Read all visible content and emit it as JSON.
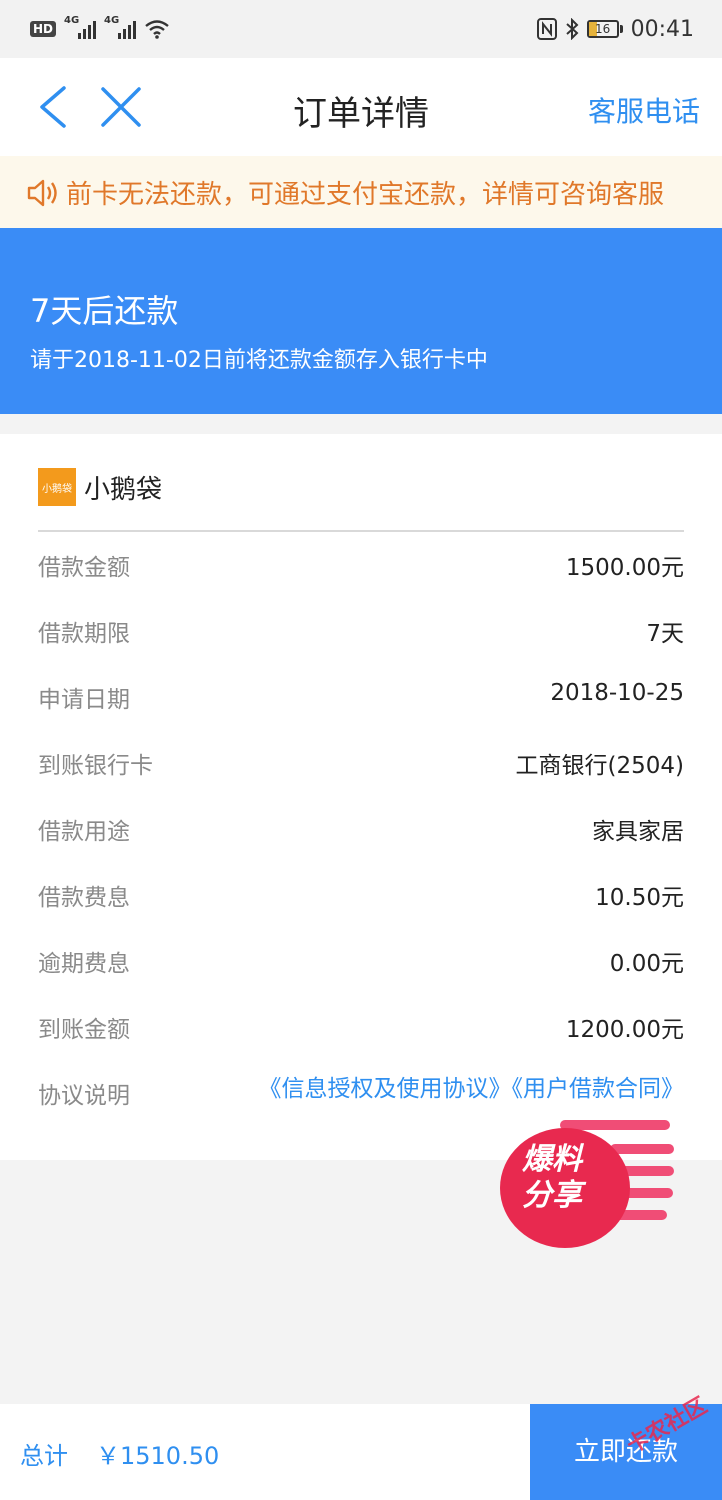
{
  "status_bar": {
    "hd": "HD",
    "net1": "4G",
    "net2": "4G",
    "battery": "16",
    "time": "00:41"
  },
  "nav": {
    "title": "订单详情",
    "service": "客服电话"
  },
  "notice": {
    "text": "前卡无法还款，可通过支付宝还款，详情可咨询客服"
  },
  "banner": {
    "title": "7天后还款",
    "subtitle": "请于2018-11-02日前将还款金额存入银行卡中"
  },
  "product": {
    "logo_text": "小鹅袋",
    "name": "小鹅袋"
  },
  "details": [
    {
      "label": "借款金额",
      "value": "1500.00元"
    },
    {
      "label": "借款期限",
      "value": "7天"
    },
    {
      "label": "申请日期",
      "value": "2018-10-25"
    },
    {
      "label": "到账银行卡",
      "value": "工商银行(2504)"
    },
    {
      "label": "借款用途",
      "value": "家具家居"
    },
    {
      "label": "借款费息",
      "value": "10.50元"
    },
    {
      "label": "逾期费息",
      "value": "0.00元"
    },
    {
      "label": "到账金额",
      "value": "1200.00元"
    },
    {
      "label": "协议说明",
      "value": "《信息授权及使用协议》《用户借款合同》"
    }
  ],
  "sticker": {
    "line1": "爆料",
    "line2": "分享"
  },
  "bottom": {
    "total_label": "总计",
    "total_amount": "￥1510.50",
    "repay_label": "立即还款"
  },
  "watermark": "卡农社区",
  "colors": {
    "accent": "#3a8cf6",
    "link": "#2f8ff0",
    "notice_text": "#e0782a",
    "notice_bg": "#fdf8eb",
    "brand": "#f39a1c"
  }
}
